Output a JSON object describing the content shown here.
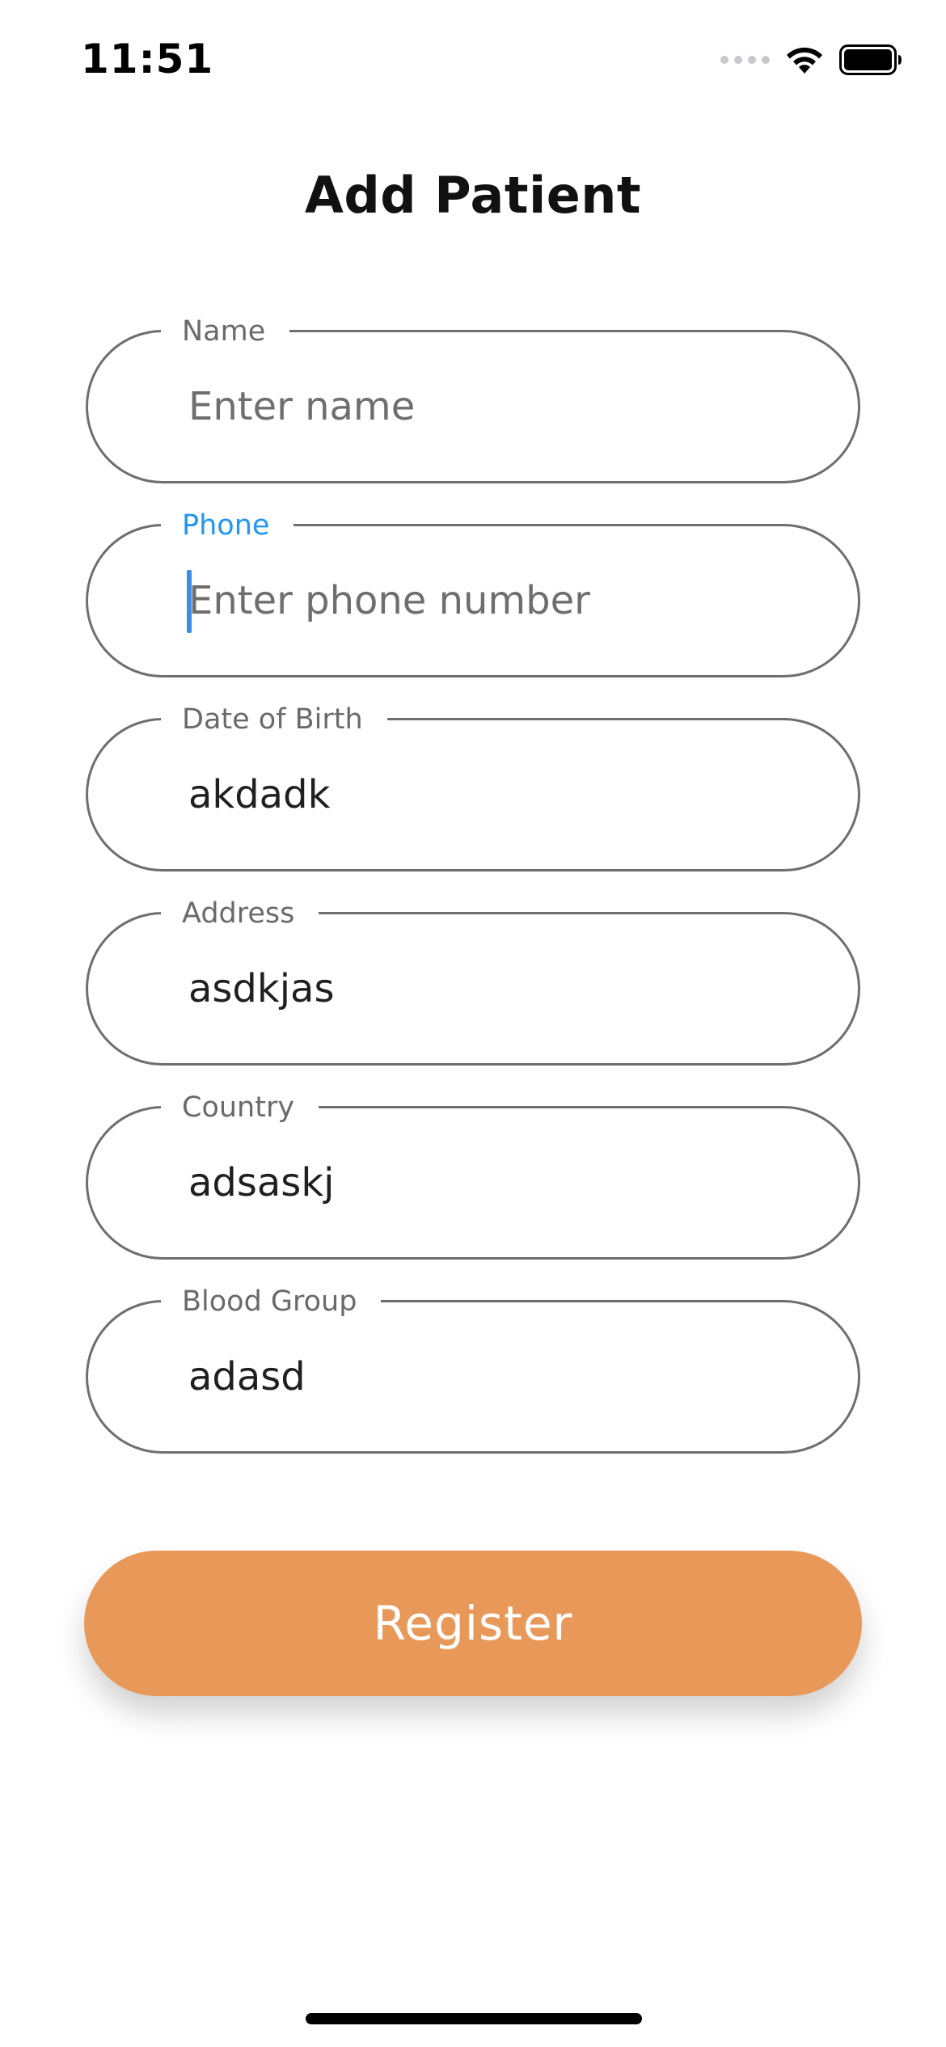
{
  "status_bar": {
    "time": "11:51"
  },
  "page": {
    "title": "Add Patient"
  },
  "form": {
    "fields": [
      {
        "label": "Name",
        "value": "",
        "placeholder": "Enter name"
      },
      {
        "label": "Phone",
        "value": "",
        "placeholder": "Enter phone number",
        "focused": true
      },
      {
        "label": "Date of Birth",
        "value": "akdadk"
      },
      {
        "label": "Address",
        "value": "asdkjas"
      },
      {
        "label": "Country",
        "value": "adsaskj"
      },
      {
        "label": "Blood Group",
        "value": "adasd"
      }
    ],
    "submit_label": "Register"
  },
  "colors": {
    "accent_button": "#e8995a",
    "focus_label": "#2196f3",
    "caret": "#3a8ee6",
    "field_border": "#6e6e6e"
  },
  "icons": [
    "cellular-signal-icon",
    "wifi-icon",
    "battery-icon"
  ]
}
